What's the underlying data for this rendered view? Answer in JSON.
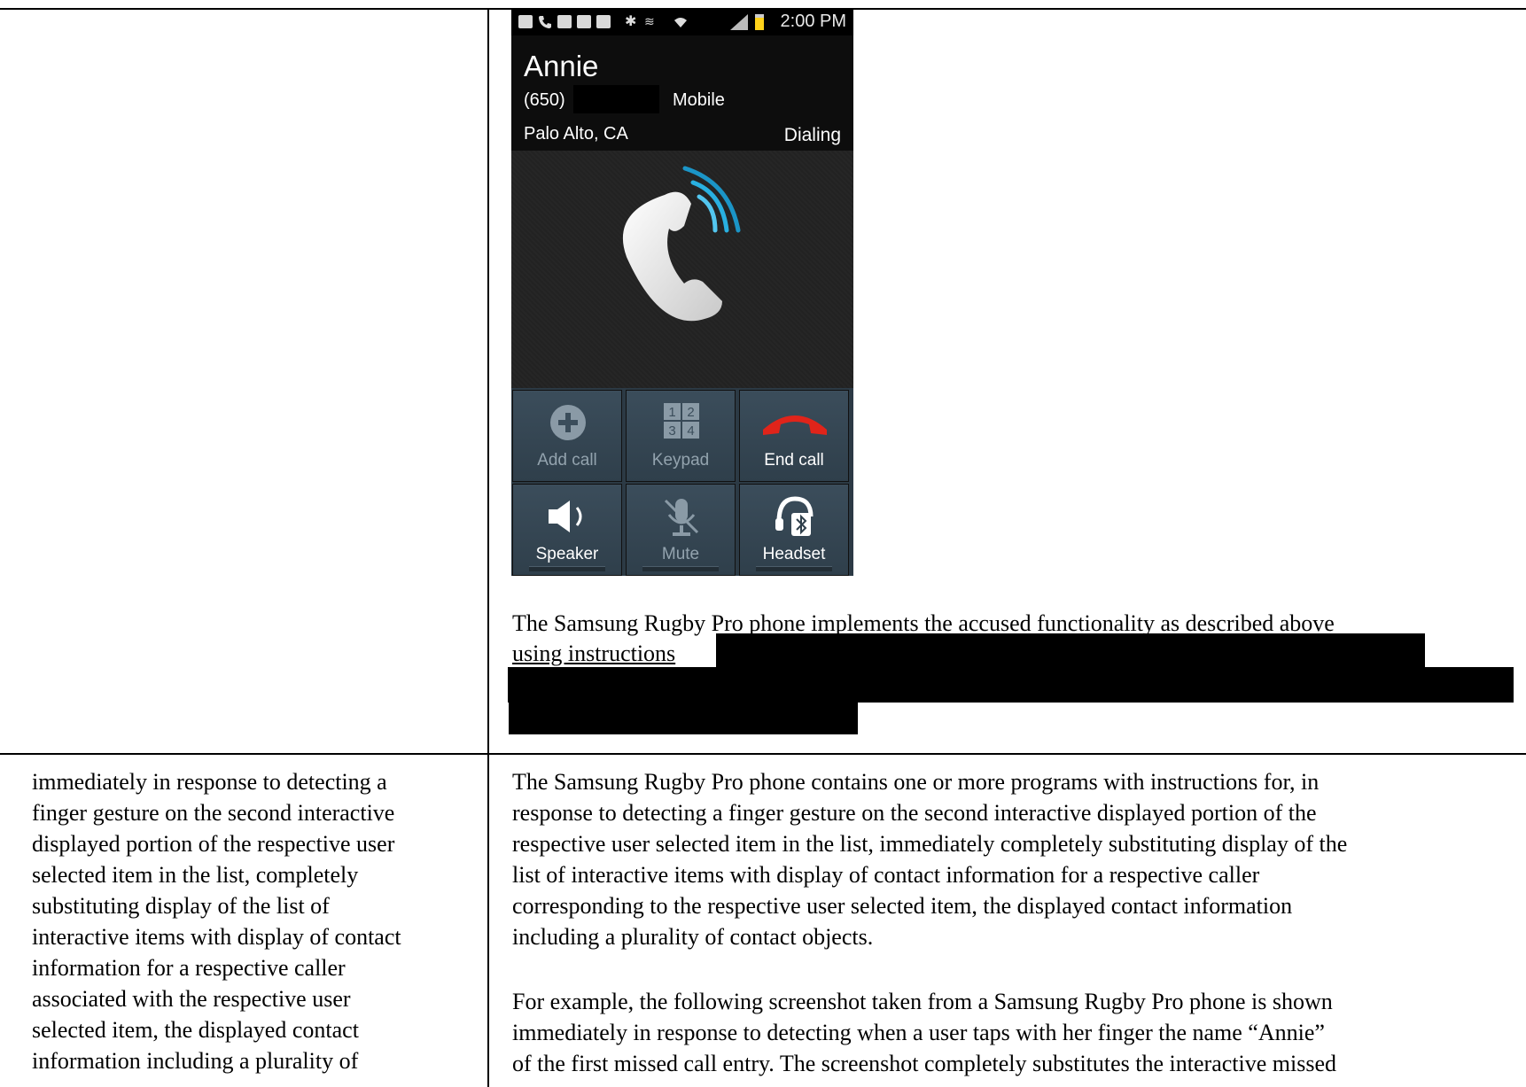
{
  "phone": {
    "status_time": "2:00 PM",
    "contact_name": "Annie",
    "contact_number": "(650)",
    "contact_type": "Mobile",
    "contact_location": "Palo Alto, CA",
    "call_status": "Dialing",
    "buttons": [
      {
        "label": "Add call",
        "icon": "add-icon",
        "enabled": false
      },
      {
        "label": "Keypad",
        "icon": "keypad-icon",
        "enabled": false
      },
      {
        "label": "End call",
        "icon": "end-call-icon",
        "enabled": true
      },
      {
        "label": "Speaker",
        "icon": "speaker-icon",
        "enabled": true
      },
      {
        "label": "Mute",
        "icon": "mute-icon",
        "enabled": false
      },
      {
        "label": "Headset",
        "icon": "headset-icon",
        "enabled": true
      }
    ],
    "keypad_digits": [
      "1",
      "2",
      "3",
      "4"
    ]
  },
  "doc": {
    "top_right_line1": "The Samsung Rugby Pro phone implements the accused functionality as described above",
    "top_right_line2": "using instructions",
    "left_lines": [
      "immediately in response to detecting a",
      "finger gesture on the second interactive",
      "displayed portion of the respective user",
      "selected item in the list, completely",
      "substituting display of the list of",
      "interactive items with display of contact",
      "information for a respective caller",
      "associated with the respective user",
      "selected item, the displayed contact",
      "information including a plurality of"
    ],
    "right_para1": [
      "The Samsung Rugby Pro phone contains one or more programs with instructions for, in",
      "response to detecting a finger gesture on the second interactive displayed portion of the",
      "respective user selected item in the list, immediately completely substituting display of the",
      "list of interactive items with display of contact information for a respective caller",
      "corresponding to the respective user selected item, the displayed contact information",
      "including a plurality of contact objects."
    ],
    "right_para2": [
      "For example, the following screenshot taken from a Samsung Rugby Pro phone is shown",
      "immediately in response to detecting when a user taps with her finger the name “Annie”",
      "of the first missed call entry.  The screenshot completely substitutes the interactive missed"
    ]
  }
}
